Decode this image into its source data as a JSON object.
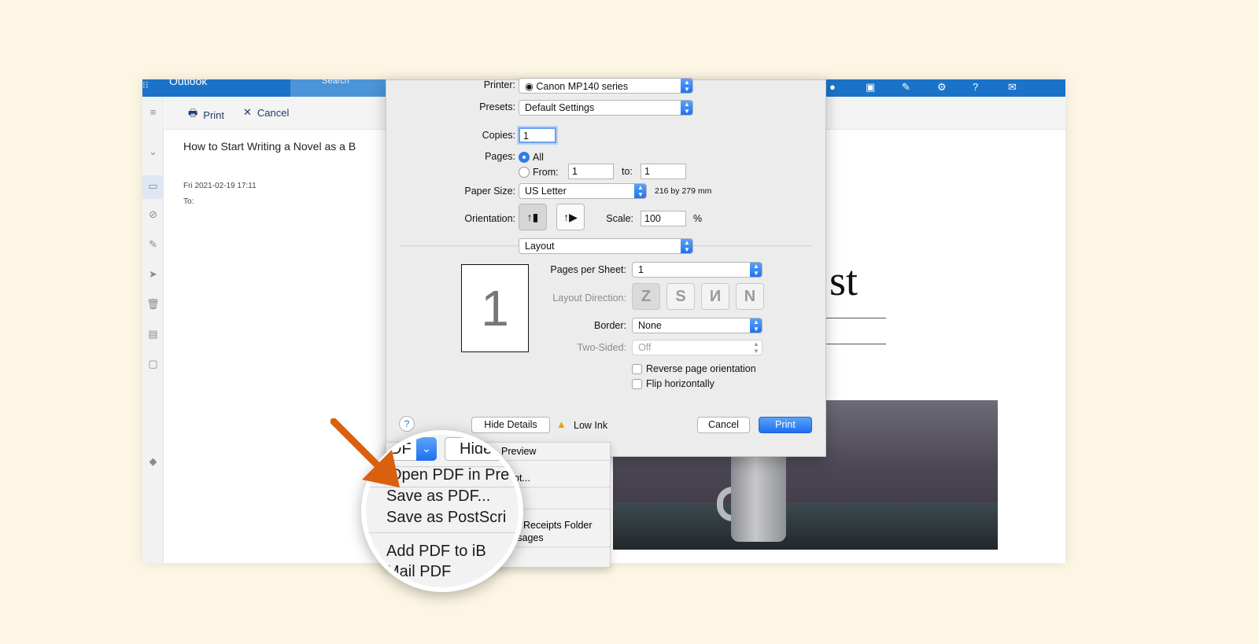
{
  "outlook": {
    "app_name": "Outlook",
    "search_placeholder": "Search",
    "toolbar": {
      "print_label": "Print",
      "cancel_label": "Cancel"
    },
    "message": {
      "subject": "How to Start Writing a Novel as a B",
      "date": "Fri 2021-02-19 17:11",
      "to_label": "To:"
    },
    "preview_heading": "st"
  },
  "print_dialog": {
    "printer_label": "Printer:",
    "printer_value": "Canon MP140 series",
    "presets_label": "Presets:",
    "presets_value": "Default Settings",
    "copies_label": "Copies:",
    "copies_value": "1",
    "pages_label": "Pages:",
    "pages_all": "All",
    "pages_from": "From:",
    "pages_from_value": "1",
    "pages_to": "to:",
    "pages_to_value": "1",
    "paper_size_label": "Paper Size:",
    "paper_size_value": "US Letter",
    "paper_size_dims": "216 by 279 mm",
    "orientation_label": "Orientation:",
    "scale_label": "Scale:",
    "scale_value": "100",
    "scale_unit": "%",
    "section_value": "Layout",
    "page_thumb_number": "1",
    "pages_per_sheet_label": "Pages per Sheet:",
    "pages_per_sheet_value": "1",
    "layout_direction_label": "Layout Direction:",
    "layout_direction_glyphs": [
      "Z",
      "S",
      "И",
      "N"
    ],
    "border_label": "Border:",
    "border_value": "None",
    "two_sided_label": "Two-Sided:",
    "two_sided_value": "Off",
    "reverse_label": "Reverse page orientation",
    "flip_label": "Flip horizontally",
    "help_label": "?",
    "hide_details_label": "Hide Details",
    "low_ink_label": "Low Ink",
    "cancel_label": "Cancel",
    "print_label": "Print"
  },
  "pdf_menu": {
    "items": [
      "Preview",
      "ot...",
      "s",
      "Receipts Folder",
      "ssages"
    ]
  },
  "magnifier": {
    "pdf_button": "DF",
    "hide_button": "Hide",
    "items": [
      "Open PDF in Pre",
      "Save as PDF...",
      "Save as PostScri",
      "Add PDF to iB",
      "Mail PDF"
    ]
  },
  "colors": {
    "accent": "#1a73c8",
    "arrow": "#d9600f",
    "page_bg": "#fdf6e4"
  }
}
